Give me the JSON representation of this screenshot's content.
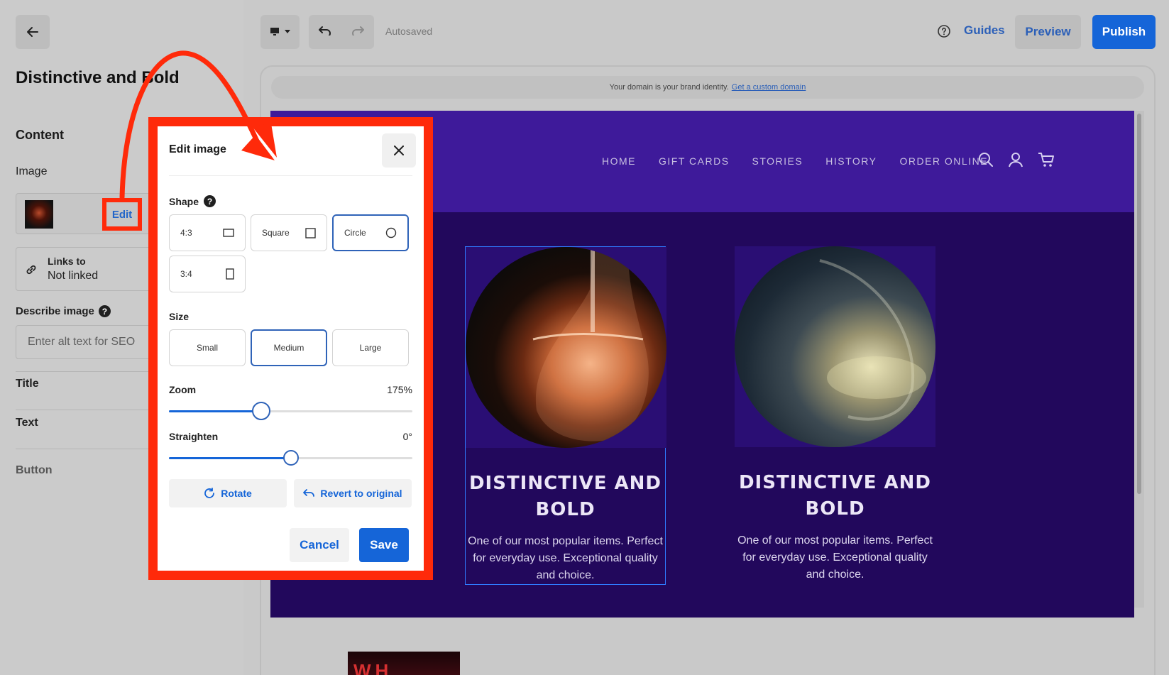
{
  "sidebar": {
    "title": "Distinctive and Bold",
    "section_heading": "Content",
    "image_label": "Image",
    "edit_label": "Edit",
    "links_to_label": "Links to",
    "links_to_value": "Not linked",
    "describe_label": "Describe image",
    "describe_help": "?",
    "alt_placeholder": "Enter alt text for SEO",
    "items": [
      {
        "label": "Title"
      },
      {
        "label": "Text"
      },
      {
        "label": "Button"
      }
    ]
  },
  "toolbar": {
    "autosaved": "Autosaved",
    "guides": "Guides",
    "preview": "Preview",
    "publish": "Publish"
  },
  "canvas": {
    "domain_text": "Your domain is your brand identity.",
    "domain_link": "Get a custom domain",
    "nav": [
      "HOME",
      "GIFT CARDS",
      "STORIES",
      "HISTORY",
      "ORDER ONLINE"
    ],
    "cards": [
      {
        "title": "Distinctive and Bold",
        "text": "One of our most popular items. Perfect for everyday use. Exceptional quality and choice."
      },
      {
        "title": "Distinctive and Bold",
        "text": "One of our most popular items. Perfect for everyday use. Exceptional quality and choice."
      }
    ]
  },
  "modal": {
    "title": "Edit image",
    "shape_label": "Shape",
    "shape_help": "?",
    "shapes": [
      {
        "label": "4:3",
        "icon": "landscape-rect-icon"
      },
      {
        "label": "Square",
        "icon": "square-icon"
      },
      {
        "label": "Circle",
        "icon": "circle-icon",
        "selected": true
      },
      {
        "label": "3:4",
        "icon": "portrait-rect-icon"
      }
    ],
    "size_label": "Size",
    "sizes": [
      {
        "label": "Small"
      },
      {
        "label": "Medium",
        "selected": true
      },
      {
        "label": "Large"
      }
    ],
    "zoom_label": "Zoom",
    "zoom_value": "175%",
    "zoom_fraction": 0.38,
    "straighten_label": "Straighten",
    "straighten_value": "0°",
    "straighten_fraction": 0.5,
    "rotate_label": "Rotate",
    "revert_label": "Revert to original",
    "cancel_label": "Cancel",
    "save_label": "Save"
  },
  "colors": {
    "accent": "#1565d8",
    "highlight": "#ff2a0a",
    "site_header": "#3e1a9a",
    "site_body": "#22085c"
  }
}
